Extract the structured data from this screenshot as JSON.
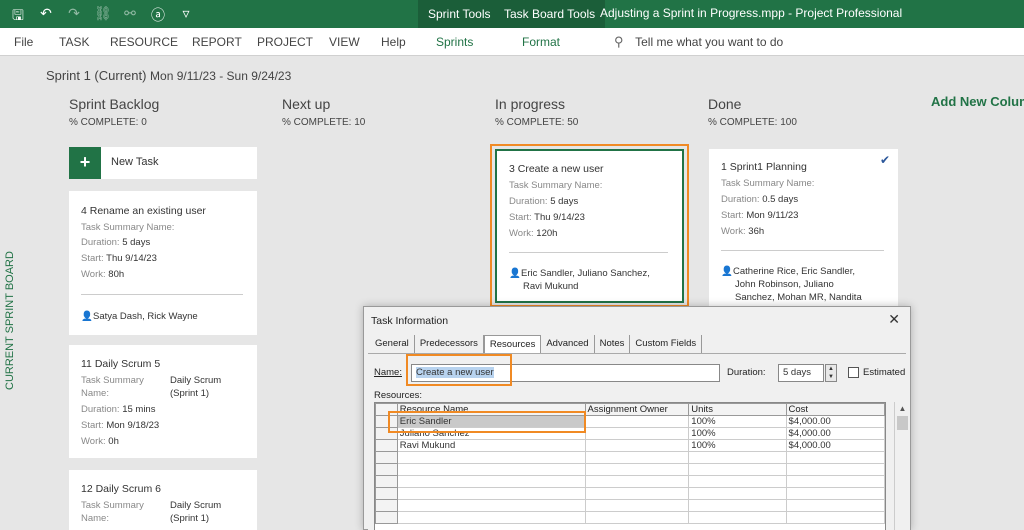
{
  "titlebar": {
    "context_tabs": [
      "Sprint Tools",
      "Task Board Tools"
    ],
    "window_title": "Adjusting a Sprint in Progress.mpp  -  Project Professional"
  },
  "ribbon": {
    "tabs": [
      "File",
      "TASK",
      "RESOURCE",
      "REPORT",
      "PROJECT",
      "VIEW",
      "Help",
      "Sprints",
      "Format"
    ],
    "tell_me": "Tell me what you want to do"
  },
  "board": {
    "sprint_title": "Sprint 1 (Current)",
    "sprint_dates": "Mon 9/11/23 - Sun 9/24/23",
    "side_label": "CURRENT SPRINT BOARD",
    "add_column": "Add New Column",
    "new_task": "New Task",
    "columns": [
      {
        "name": "Sprint Backlog",
        "pct": "% COMPLETE: 0"
      },
      {
        "name": "Next up",
        "pct": "% COMPLETE: 10"
      },
      {
        "name": "In progress",
        "pct": "% COMPLETE: 50"
      },
      {
        "name": "Done",
        "pct": "% COMPLETE: 100"
      }
    ],
    "labels": {
      "summary": "Task Summary Name:",
      "summary_a": "Task Summary",
      "summary_b": "Name:",
      "duration": "Duration:",
      "start": "Start:",
      "work": "Work:"
    },
    "cards": {
      "rename": {
        "title": "4  Rename an existing user",
        "duration": "5 days",
        "start": "Thu 9/14/23",
        "work": "80h",
        "resources": "Satya Dash, Rick Wayne"
      },
      "scrum5": {
        "title": "11  Daily Scrum 5",
        "summary_1": "Daily Scrum",
        "summary_2": "(Sprint 1)",
        "duration": "15 mins",
        "start": "Mon 9/18/23",
        "work": "0h"
      },
      "scrum6": {
        "title": "12  Daily Scrum 6",
        "summary_1": "Daily Scrum",
        "summary_2": "(Sprint 1)"
      },
      "create": {
        "title": "3  Create a new user",
        "duration": "5 days",
        "start": "Thu 9/14/23",
        "work": "120h",
        "resources_1": "Eric Sandler, Juliano Sanchez,",
        "resources_2": "Ravi Mukund"
      },
      "planning": {
        "title": "1  Sprint1 Planning",
        "duration": "0.5 days",
        "start": "Mon 9/11/23",
        "work": "36h",
        "resources_1": "Catherine Rice, Eric Sandler,",
        "resources_2": "John Robinson, Juliano",
        "resources_3": "Sanchez, Mohan MR, Nandita"
      }
    }
  },
  "dialog": {
    "title": "Task Information",
    "tabs": [
      "General",
      "Predecessors",
      "Resources",
      "Advanced",
      "Notes",
      "Custom Fields"
    ],
    "active_tab": "Resources",
    "name_label": "Name:",
    "name_value": "Create a new user",
    "duration_label": "Duration:",
    "duration_value": "5 days",
    "estimated_label": "Estimated",
    "resources_label": "Resources:",
    "columns": [
      "Resource Name",
      "Assignment Owner",
      "Units",
      "Cost"
    ],
    "rows": [
      {
        "name": "Eric Sandler",
        "owner": "",
        "units": "100%",
        "cost": "$4,000.00"
      },
      {
        "name": "Juliano Sanchez",
        "owner": "",
        "units": "100%",
        "cost": "$4,000.00"
      },
      {
        "name": "Ravi Mukund",
        "owner": "",
        "units": "100%",
        "cost": "$4,000.00"
      }
    ]
  },
  "colors": {
    "accent": "#217346",
    "highlight": "#f08a24"
  }
}
